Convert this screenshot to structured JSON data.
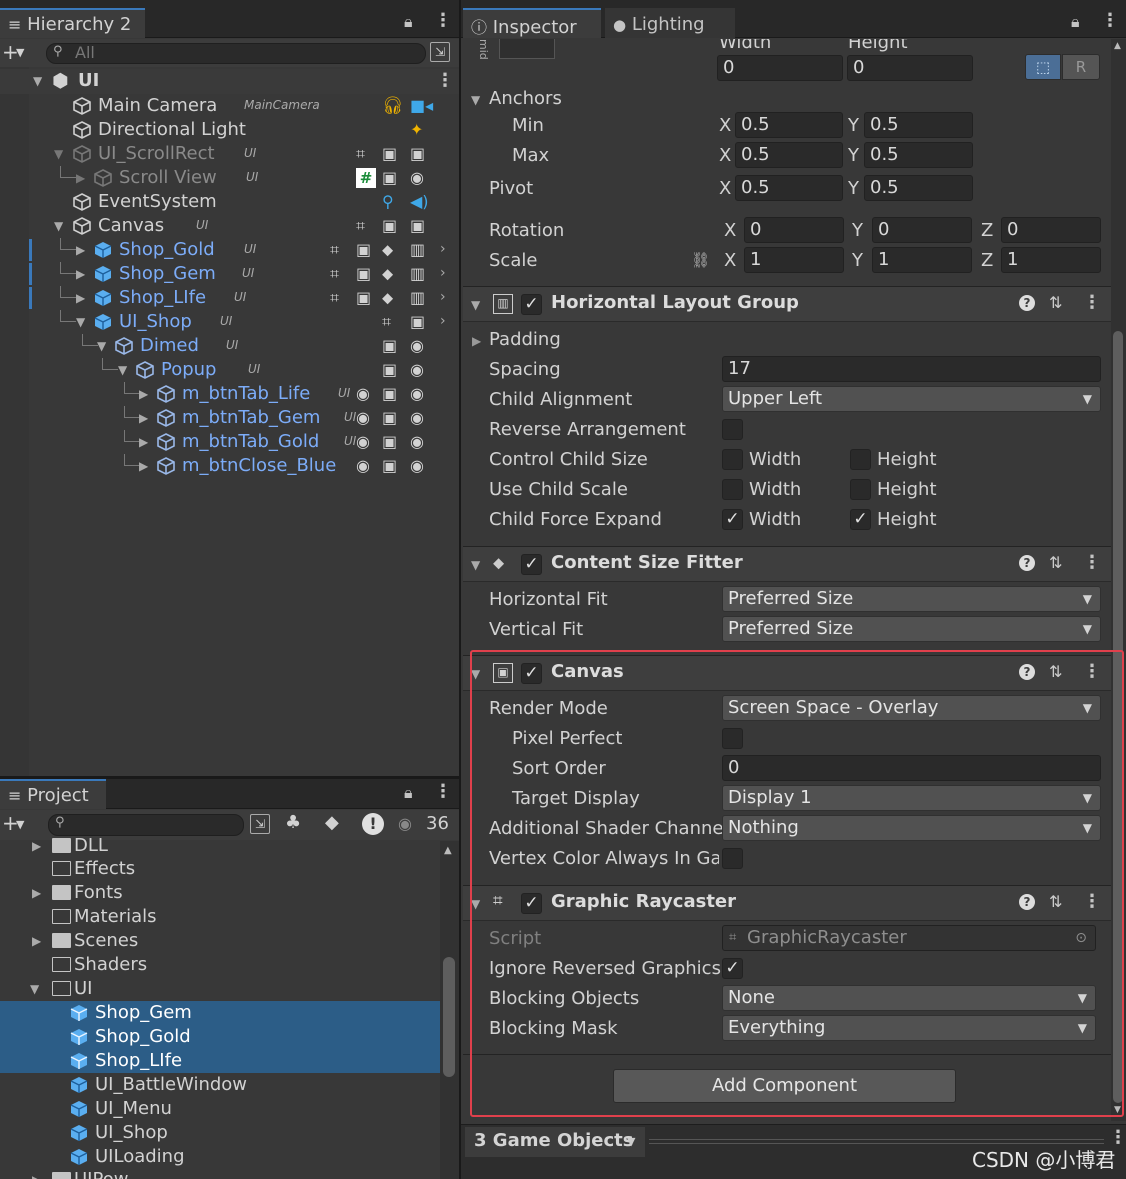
{
  "hierarchy": {
    "tab_label": "Hierarchy 2",
    "search_placeholder": "All",
    "scene_name": "UI",
    "rows": [
      {
        "label": "Main Camera",
        "tag": "MainCamera"
      },
      {
        "label": "Directional Light"
      },
      {
        "label": "UI_ScrollRect",
        "tag": "UI"
      },
      {
        "label": "Scroll View",
        "tag": "UI"
      },
      {
        "label": "EventSystem"
      },
      {
        "label": "Canvas",
        "tag": "UI"
      },
      {
        "label": "Shop_Gold",
        "tag": "UI"
      },
      {
        "label": "Shop_Gem",
        "tag": "UI"
      },
      {
        "label": "Shop_LIfe",
        "tag": "UI"
      },
      {
        "label": "UI_Shop",
        "tag": "UI"
      },
      {
        "label": "Dimed",
        "tag": "UI"
      },
      {
        "label": "Popup",
        "tag": "UI"
      },
      {
        "label": "m_btnTab_Life",
        "tag": "UI"
      },
      {
        "label": "m_btnTab_Gem",
        "tag": "UI"
      },
      {
        "label": "m_btnTab_Gold",
        "tag": "UI"
      },
      {
        "label": "m_btnClose_Blue"
      }
    ]
  },
  "project": {
    "tab_label": "Project",
    "hidden_count": "36",
    "items": [
      {
        "label": "DLL"
      },
      {
        "label": "Effects"
      },
      {
        "label": "Fonts"
      },
      {
        "label": "Materials"
      },
      {
        "label": "Scenes"
      },
      {
        "label": "Shaders"
      },
      {
        "label": "UI"
      },
      {
        "label": "Shop_Gem"
      },
      {
        "label": "Shop_Gold"
      },
      {
        "label": "Shop_LIfe"
      },
      {
        "label": "UI_BattleWindow"
      },
      {
        "label": "UI_Menu"
      },
      {
        "label": "UI_Shop"
      },
      {
        "label": "UILoading"
      },
      {
        "label": "UIPow"
      }
    ]
  },
  "inspector": {
    "tab_label": "Inspector",
    "lighting_tab_label": "Lighting",
    "rect": {
      "width_label": "Width",
      "height_label": "Height",
      "width_value": "0",
      "height_value": "0",
      "r_button": "R",
      "anchors_label": "Anchors",
      "min_label": "Min",
      "max_label": "Max",
      "pivot_label": "Pivot",
      "x": "X",
      "y": "Y",
      "z": "Z",
      "min_x": "0.5",
      "min_y": "0.5",
      "max_x": "0.5",
      "max_y": "0.5",
      "pivot_x": "0.5",
      "pivot_y": "0.5",
      "rotation_label": "Rotation",
      "rot_x": "0",
      "rot_y": "0",
      "rot_z": "0",
      "scale_label": "Scale",
      "scale_x": "1",
      "scale_y": "1",
      "scale_z": "1"
    },
    "hlg": {
      "title": "Horizontal Layout Group",
      "padding_label": "Padding",
      "spacing_label": "Spacing",
      "spacing_value": "17",
      "child_alignment_label": "Child Alignment",
      "child_alignment_value": "Upper Left",
      "reverse_label": "Reverse Arrangement",
      "control_label": "Control Child Size",
      "use_scale_label": "Use Child Scale",
      "force_label": "Child Force Expand",
      "width": "Width",
      "height": "Height"
    },
    "csf": {
      "title": "Content Size Fitter",
      "hfit_label": "Horizontal Fit",
      "hfit_value": "Preferred Size",
      "vfit_label": "Vertical Fit",
      "vfit_value": "Preferred Size"
    },
    "canvas": {
      "title": "Canvas",
      "render_mode_label": "Render Mode",
      "render_mode_value": "Screen Space - Overlay",
      "pixel_perfect_label": "Pixel Perfect",
      "sort_order_label": "Sort Order",
      "sort_order_value": "0",
      "target_display_label": "Target Display",
      "target_display_value": "Display 1",
      "shader_channels_label": "Additional Shader Channe",
      "shader_channels_value": "Nothing",
      "vertex_color_label": "Vertex Color Always In Gai"
    },
    "raycaster": {
      "title": "Graphic Raycaster",
      "script_label": "Script",
      "script_value": "GraphicRaycaster",
      "ignore_label": "Ignore Reversed Graphics",
      "blocking_objects_label": "Blocking Objects",
      "blocking_objects_value": "None",
      "blocking_mask_label": "Blocking Mask",
      "blocking_mask_value": "Everything"
    },
    "add_component": "Add Component",
    "footer": "3 Game Objects"
  },
  "watermark": "CSDN @小博君",
  "colors": {
    "accent": "#3a79bb",
    "selection": "#2c5d87",
    "highlight_box": "#e0404c",
    "prefab_blue": "#7cacf8"
  }
}
